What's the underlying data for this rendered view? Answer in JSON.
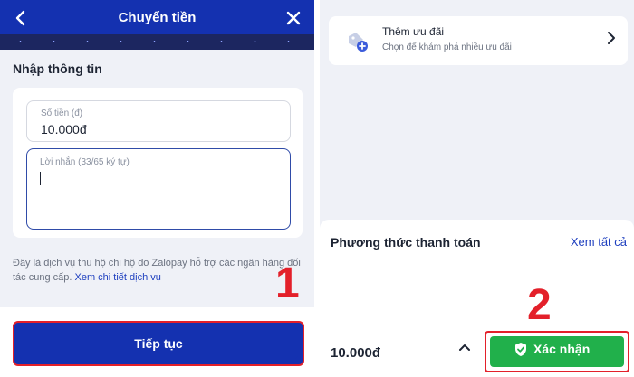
{
  "left": {
    "header": {
      "title": "Chuyển tiền"
    },
    "section_title": "Nhập thông tin",
    "amount": {
      "label": "Số tiền (đ)",
      "value": "10.000đ"
    },
    "message": {
      "label": "Lời nhắn (33/65 ký tự)"
    },
    "note": {
      "text": "Đây là dịch vụ thu hộ chi hộ do Zalopay hỗ trợ các ngân hàng đối tác cung cấp.",
      "link": "Xem chi tiết dịch vụ"
    },
    "step_number": "1",
    "continue_label": "Tiếp tục"
  },
  "right": {
    "promo": {
      "title": "Thêm ưu đãi",
      "subtitle": "Chọn để khám phá nhiều ưu đãi"
    },
    "payment": {
      "title": "Phương thức thanh toán",
      "see_all": "Xem tất cả"
    },
    "step_number": "2",
    "total": "10.000đ",
    "confirm_label": "Xác nhận"
  },
  "colors": {
    "primary": "#1431b0",
    "highlight": "#e3202a",
    "confirm": "#21b04b"
  },
  "icons": [
    "back-arrow-icon",
    "close-icon",
    "promo-voucher-icon",
    "chevron-right-icon",
    "chevron-up-icon",
    "shield-check-icon"
  ]
}
